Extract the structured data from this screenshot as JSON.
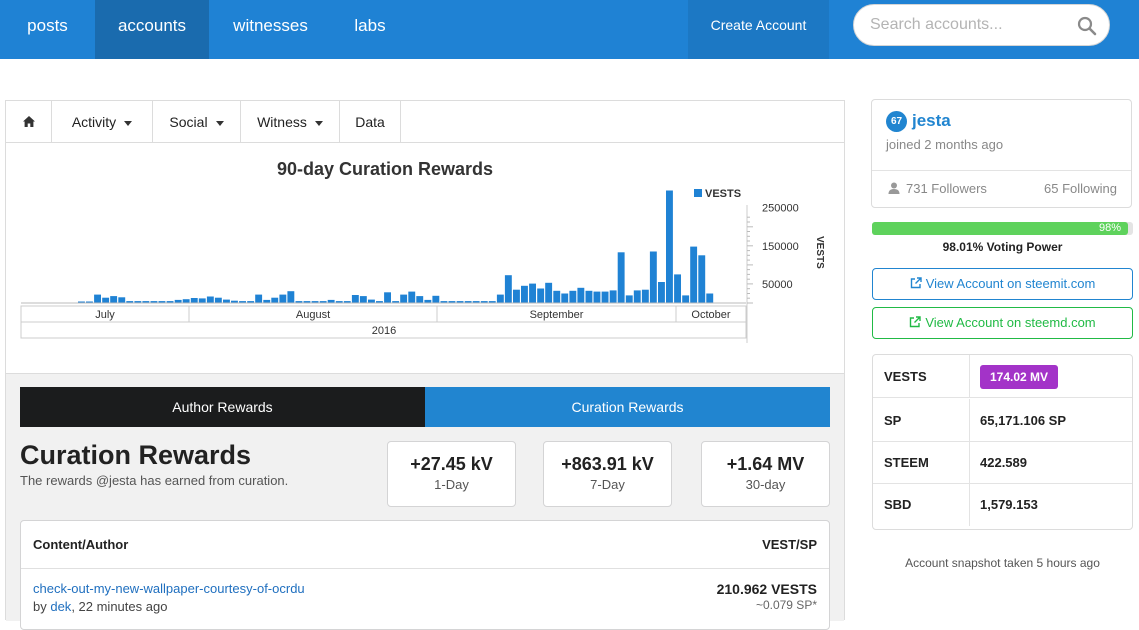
{
  "nav": {
    "items": [
      {
        "label": "posts",
        "active": false
      },
      {
        "label": "accounts",
        "active": true
      },
      {
        "label": "witnesses",
        "active": false
      },
      {
        "label": "labs",
        "active": false
      }
    ],
    "create_account": "Create Account",
    "search_placeholder": "Search accounts..."
  },
  "tabs": {
    "home_icon": "home-icon",
    "activity": "Activity",
    "social": "Social",
    "witness": "Witness",
    "data": "Data"
  },
  "chart_data": {
    "type": "bar",
    "title": "90-day Curation Rewards",
    "legend": [
      "VESTS"
    ],
    "legend_position": "top-right",
    "series": [
      {
        "name": "VESTS",
        "color": "#1f82d4"
      }
    ],
    "ylim": [
      0,
      320000
    ],
    "yticks": [
      50000,
      150000,
      250000
    ],
    "ytick_labels": [
      "50000",
      "150000",
      "250000"
    ],
    "ylabel": "VESTS",
    "month_labels": [
      "July",
      "August",
      "September",
      "October"
    ],
    "year_label": "2016",
    "start_date": "2016-07-15",
    "values": [
      0,
      0,
      0,
      0,
      0,
      0,
      0,
      0,
      0,
      0,
      0,
      0,
      0,
      0,
      0,
      0,
      0,
      0,
      0,
      0,
      0,
      0,
      0,
      0,
      0,
      0,
      0,
      0,
      0,
      0,
      0,
      0,
      0,
      0,
      0,
      0,
      0,
      0,
      0,
      0,
      0,
      0,
      0,
      0,
      0,
      0,
      0,
      0,
      0,
      0,
      0,
      0,
      0,
      0,
      0,
      0,
      0,
      0,
      0,
      0,
      0,
      0,
      0,
      0,
      0,
      0,
      0,
      0,
      0,
      0,
      0,
      0,
      0,
      0,
      0,
      0,
      0,
      0,
      0,
      0,
      0,
      0,
      0,
      0,
      0,
      0,
      0,
      0,
      0,
      0
    ],
    "bars": [
      {
        "day": 0,
        "value": 0
      },
      {
        "day": 7,
        "value": 4000
      },
      {
        "day": 8,
        "value": 4000
      },
      {
        "day": 9,
        "value": 22000
      },
      {
        "day": 10,
        "value": 14000
      },
      {
        "day": 11,
        "value": 18000
      },
      {
        "day": 12,
        "value": 15000
      },
      {
        "day": 13,
        "value": 5000
      },
      {
        "day": 14,
        "value": 5000
      },
      {
        "day": 15,
        "value": 5000
      },
      {
        "day": 16,
        "value": 5000
      },
      {
        "day": 17,
        "value": 5000
      },
      {
        "day": 18,
        "value": 5000
      },
      {
        "day": 19,
        "value": 8000
      },
      {
        "day": 20,
        "value": 10000
      },
      {
        "day": 21,
        "value": 13000
      },
      {
        "day": 22,
        "value": 12000
      },
      {
        "day": 23,
        "value": 17000
      },
      {
        "day": 24,
        "value": 14000
      },
      {
        "day": 25,
        "value": 9000
      },
      {
        "day": 26,
        "value": 6000
      },
      {
        "day": 27,
        "value": 5000
      },
      {
        "day": 28,
        "value": 5000
      },
      {
        "day": 29,
        "value": 22000
      },
      {
        "day": 30,
        "value": 8000
      },
      {
        "day": 31,
        "value": 14000
      },
      {
        "day": 32,
        "value": 22000
      },
      {
        "day": 33,
        "value": 31000
      },
      {
        "day": 34,
        "value": 5000
      },
      {
        "day": 35,
        "value": 5000
      },
      {
        "day": 36,
        "value": 5000
      },
      {
        "day": 37,
        "value": 5000
      },
      {
        "day": 38,
        "value": 8000
      },
      {
        "day": 39,
        "value": 5000
      },
      {
        "day": 40,
        "value": 5000
      },
      {
        "day": 41,
        "value": 21000
      },
      {
        "day": 42,
        "value": 18000
      },
      {
        "day": 43,
        "value": 9000
      },
      {
        "day": 44,
        "value": 5000
      },
      {
        "day": 45,
        "value": 28000
      },
      {
        "day": 46,
        "value": 5000
      },
      {
        "day": 47,
        "value": 22000
      },
      {
        "day": 48,
        "value": 30000
      },
      {
        "day": 49,
        "value": 18000
      },
      {
        "day": 50,
        "value": 8000
      },
      {
        "day": 51,
        "value": 19000
      },
      {
        "day": 52,
        "value": 5000
      },
      {
        "day": 53,
        "value": 5000
      },
      {
        "day": 54,
        "value": 5000
      },
      {
        "day": 55,
        "value": 5000
      },
      {
        "day": 56,
        "value": 5000
      },
      {
        "day": 57,
        "value": 5000
      },
      {
        "day": 58,
        "value": 5000
      },
      {
        "day": 59,
        "value": 22000
      },
      {
        "day": 60,
        "value": 73000
      },
      {
        "day": 61,
        "value": 35000
      },
      {
        "day": 62,
        "value": 45000
      },
      {
        "day": 63,
        "value": 51000
      },
      {
        "day": 64,
        "value": 38000
      },
      {
        "day": 65,
        "value": 53000
      },
      {
        "day": 66,
        "value": 32000
      },
      {
        "day": 67,
        "value": 25000
      },
      {
        "day": 68,
        "value": 32000
      },
      {
        "day": 69,
        "value": 40000
      },
      {
        "day": 70,
        "value": 32000
      },
      {
        "day": 71,
        "value": 30000
      },
      {
        "day": 72,
        "value": 30000
      },
      {
        "day": 73,
        "value": 33000
      },
      {
        "day": 74,
        "value": 133000
      },
      {
        "day": 75,
        "value": 20000
      },
      {
        "day": 76,
        "value": 33000
      },
      {
        "day": 77,
        "value": 35000
      },
      {
        "day": 78,
        "value": 135000
      },
      {
        "day": 79,
        "value": 55000
      },
      {
        "day": 80,
        "value": 295000
      },
      {
        "day": 81,
        "value": 75000
      },
      {
        "day": 82,
        "value": 20000
      },
      {
        "day": 83,
        "value": 148000
      },
      {
        "day": 84,
        "value": 125000
      },
      {
        "day": 85,
        "value": 25000
      }
    ]
  },
  "reward_tabs": {
    "author": "Author Rewards",
    "curation": "Curation Rewards"
  },
  "section": {
    "title": "Curation Rewards",
    "subtitle": "The rewards @jesta has earned from curation."
  },
  "stats": [
    {
      "value": "+27.45 kV",
      "label": "1-Day"
    },
    {
      "value": "+863.91 kV",
      "label": "7-Day"
    },
    {
      "value": "+1.64 MV",
      "label": "30-day"
    }
  ],
  "table": {
    "col_content": "Content/Author",
    "col_vest": "VEST/SP",
    "rows": [
      {
        "link": "check-out-my-new-wallpaper-courtesy-of-ocrdu",
        "by_prefix": "by ",
        "author": "dek",
        "time": ", 22 minutes ago",
        "vests": "210.962 VESTS",
        "sp": "~0.079 SP*"
      }
    ]
  },
  "profile": {
    "reputation": "67",
    "username": "jesta",
    "joined": "joined 2 months ago",
    "followers": "731 Followers",
    "following": "65 Following"
  },
  "voting_power": {
    "percent": 98,
    "percent_label": "98%",
    "label": "98.01% Voting Power"
  },
  "links": {
    "steemit": "View Account on steemit.com",
    "steemd": "View Account on steemd.com"
  },
  "balances": [
    {
      "key": "VESTS",
      "value": "174.02 MV",
      "badge": true
    },
    {
      "key": "SP",
      "value": "65,171.106 SP",
      "badge": false
    },
    {
      "key": "STEEM",
      "value": "422.589",
      "badge": false
    },
    {
      "key": "SBD",
      "value": "1,579.153",
      "badge": false
    }
  ],
  "snapshot": "Account snapshot taken 5 hours ago",
  "colors": {
    "primary": "#1f82d4",
    "dark": "#1b1c1d",
    "green": "#5ed25c",
    "purple": "#a333c8"
  }
}
